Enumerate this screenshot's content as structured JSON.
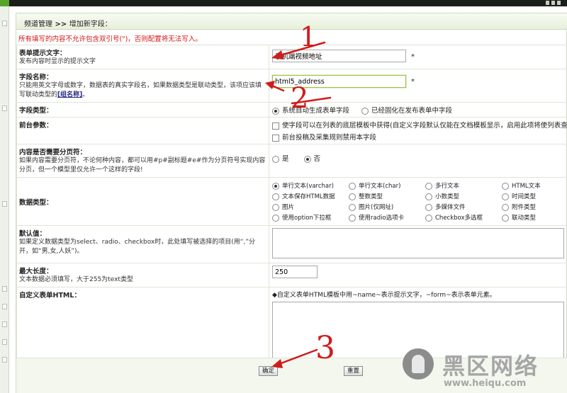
{
  "header": {
    "breadcrumb_parent": "频道管理",
    "separator": ">>",
    "breadcrumb_current": "增加新字段："
  },
  "warning": "所有填写的内容不允许包含双引号(\")，否则配置将无法写入。",
  "fields": {
    "prompt_text": {
      "label": "表单提示文字：",
      "desc": "发布内容时显示的提示文字",
      "value": "手机端视频地址",
      "required": "*"
    },
    "field_name": {
      "label": "字段名称：",
      "desc": "只能用英文字母或数字，数据表的真实字段名，如果数据类型是联动类型，该项应该填写联动类型的",
      "desc_link": "[组名称]",
      "desc_end": "。",
      "value": "html5_address",
      "required": "*"
    },
    "field_type": {
      "label": "字段类型：",
      "options": [
        "系统自动生成表单字段",
        "已经固化在发布表单中字段"
      ],
      "selected": 0
    },
    "frontend": {
      "label": "前台参数：",
      "options": [
        "使字段可以在列表的底层模板中获得(自定义字段默认仅能在文档模板显示，启用此项将使列表查询变",
        "前台投稿及采集规则禁用本字段"
      ]
    },
    "paging": {
      "label": "内容是否需要分页符：",
      "desc": "如果内容需要分页符，不论何种内容，都可以用#p#副标题#e#作为分页符号实现内容分页，但一个模型里仅允许一个这样的字段!",
      "options": [
        "是",
        "否"
      ],
      "selected": 1
    },
    "data_type": {
      "label": "数据类型：",
      "options": [
        "单行文本(varchar)",
        "单行文本(char)",
        "多行文本",
        "HTML文本",
        "文本保存HTML数据",
        "整数类型",
        "小数类型",
        "时间类型",
        "图片",
        "图片(仅网址)",
        "多媒体文件",
        "附件类型",
        "使用option下拉框",
        "使用radio选项卡",
        "Checkbox多选框",
        "联动类型"
      ],
      "selected": 0
    },
    "default_value": {
      "label": "默认值：",
      "desc": "如果定义数据类型为select、radio、checkbox时，此处填写被选择的项目(用“,”分开，如“男,女,人妖”)。"
    },
    "max_length": {
      "label": "最大长度：",
      "desc": "文本数据必须填写，大于255为text类型",
      "value": "250"
    },
    "custom_html": {
      "label": "自定义表单HTML：",
      "hint": "◆自定义表单HTML模板中用~name~表示提示文字，~form~表示表单元素。"
    }
  },
  "buttons": {
    "confirm": "确定",
    "reset": "重置"
  },
  "annotations": [
    "1",
    "2",
    "3"
  ],
  "watermark": {
    "text": "黑区网络",
    "url": "www.heiqu.com"
  },
  "colors": {
    "warning": "#d01515",
    "annotation": "#d01c1c",
    "title_bg": "#e7f0dc"
  }
}
